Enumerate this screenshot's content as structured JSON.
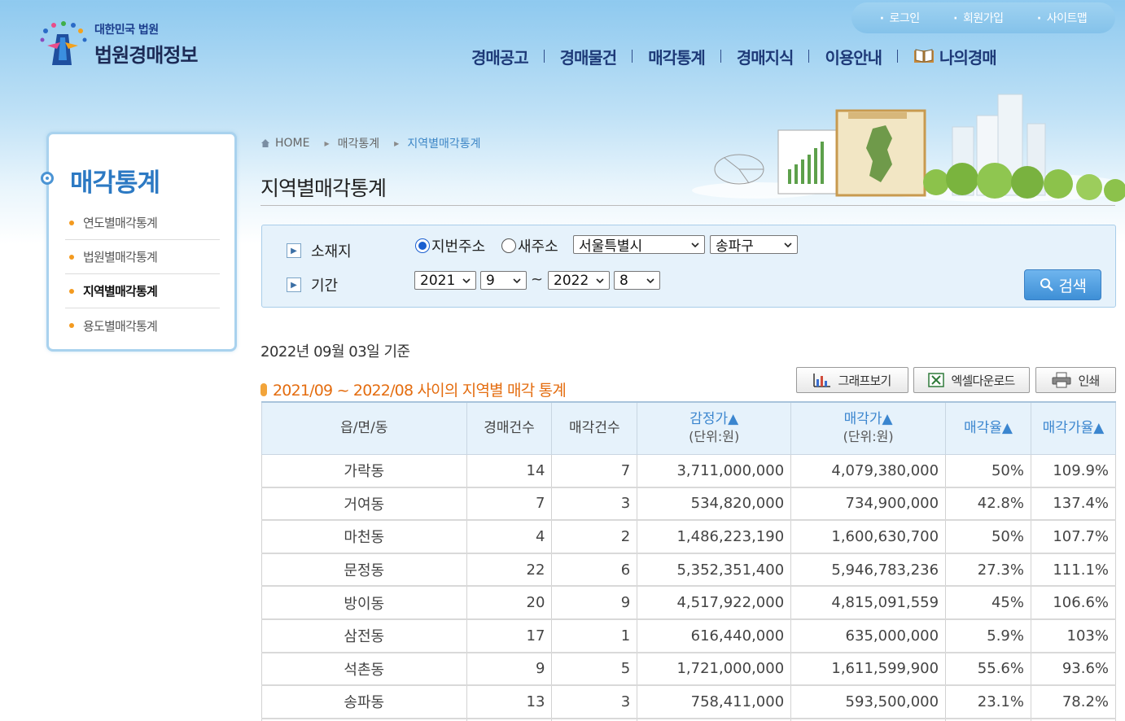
{
  "header": {
    "logo_sub": "대한민국 법원",
    "logo_main": "법원경매정보",
    "top_links": [
      "로그인",
      "회원가입",
      "사이트맵"
    ],
    "nav": [
      "경매공고",
      "경매물건",
      "매각통계",
      "경매지식",
      "이용안내",
      "나의경매"
    ]
  },
  "sidebar": {
    "title": "매각통계",
    "items": [
      {
        "label": "연도별매각통계"
      },
      {
        "label": "법원별매각통계"
      },
      {
        "label": "지역별매각통계"
      },
      {
        "label": "용도별매각통계"
      }
    ]
  },
  "breadcrumb": [
    "HOME",
    "매각통계",
    "지역별매각통계"
  ],
  "page_title": "지역별매각통계",
  "search": {
    "location_label": "소재지",
    "period_label": "기간",
    "radio_jibun": "지번주소",
    "radio_new": "새주소",
    "city": "서울특별시",
    "district": "송파구",
    "start_year": "2021",
    "start_month": "9",
    "tilde": "~",
    "end_year": "2022",
    "end_month": "8",
    "search_button": "검색"
  },
  "basis_date": "2022년 09월 03일 기준",
  "stat_title": "2021/09 ~ 2022/08 사이의 지역별 매각 통계",
  "tools": {
    "graph": "그래프보기",
    "excel": "엑셀다운로드",
    "print": "인쇄"
  },
  "table": {
    "headers": {
      "area": "읍/면/동",
      "auction_count": "경매건수",
      "sale_count": "매각건수",
      "appraisal": "감정가▲",
      "appraisal_unit": "(단위:원)",
      "sale_price": "매각가▲",
      "sale_price_unit": "(단위:원)",
      "sale_rate": "매각율▲",
      "price_rate": "매각가율▲"
    },
    "rows": [
      {
        "area": "가락동",
        "auction": "14",
        "sold": "7",
        "appraisal": "3,711,000,000",
        "price": "4,079,380,000",
        "rate": "50%",
        "price_rate": "109.9%"
      },
      {
        "area": "거여동",
        "auction": "7",
        "sold": "3",
        "appraisal": "534,820,000",
        "price": "734,900,000",
        "rate": "42.8%",
        "price_rate": "137.4%"
      },
      {
        "area": "마천동",
        "auction": "4",
        "sold": "2",
        "appraisal": "1,486,223,190",
        "price": "1,600,630,700",
        "rate": "50%",
        "price_rate": "107.7%"
      },
      {
        "area": "문정동",
        "auction": "22",
        "sold": "6",
        "appraisal": "5,352,351,400",
        "price": "5,946,783,236",
        "rate": "27.3%",
        "price_rate": "111.1%"
      },
      {
        "area": "방이동",
        "auction": "20",
        "sold": "9",
        "appraisal": "4,517,922,000",
        "price": "4,815,091,559",
        "rate": "45%",
        "price_rate": "106.6%"
      },
      {
        "area": "삼전동",
        "auction": "17",
        "sold": "1",
        "appraisal": "616,440,000",
        "price": "635,000,000",
        "rate": "5.9%",
        "price_rate": "103%"
      },
      {
        "area": "석촌동",
        "auction": "9",
        "sold": "5",
        "appraisal": "1,721,000,000",
        "price": "1,611,599,900",
        "rate": "55.6%",
        "price_rate": "93.6%"
      },
      {
        "area": "송파동",
        "auction": "13",
        "sold": "3",
        "appraisal": "758,411,000",
        "price": "593,500,000",
        "rate": "23.1%",
        "price_rate": "78.2%"
      }
    ]
  },
  "colors": {
    "brand_blue": "#2c79c3",
    "nav_text": "#1e3a78",
    "accent_orange": "#e46d10",
    "header_bg": "#e6f2fb"
  }
}
